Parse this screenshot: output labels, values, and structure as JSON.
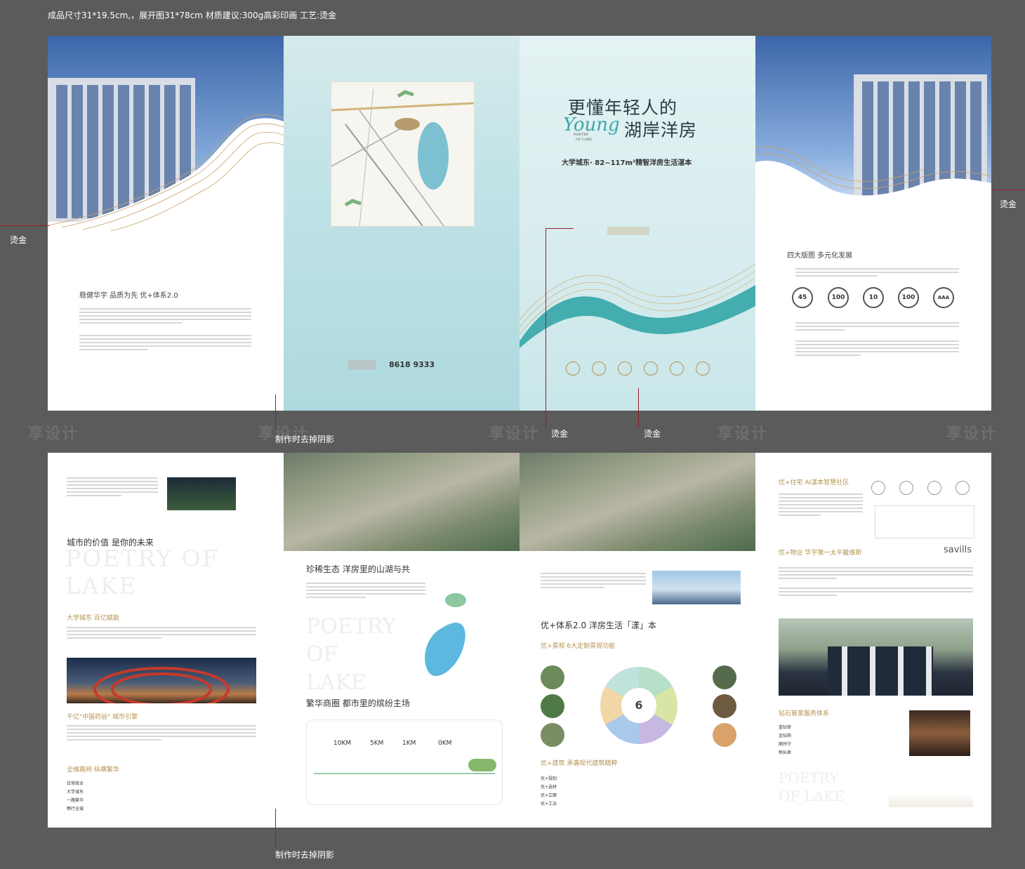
{
  "header": {
    "spec_text": "成品尺寸31*19.5cm,，展开图31*78cm  材质建议:300g高彩印画   工艺:烫金"
  },
  "notes": {
    "hot_stamp_left": "烫金",
    "hot_stamp_right": "烫金",
    "hot_stamp_mid1": "烫金",
    "hot_stamp_mid2": "烫金",
    "remove_shadow_top": "制作时去掉阴影",
    "remove_shadow_bottom": "制作时去掉阴影"
  },
  "watermark": "享设计",
  "page1": {
    "heading": "稳健华宇  品质为先  优+体系2.0"
  },
  "page2": {
    "phone": "8618 9333"
  },
  "cover": {
    "title_line1": "更懂年轻人的",
    "title_line2": "湖岸洋房",
    "script": "Young",
    "sub_en1": "POETRY",
    "sub_en2": "OF LAKE",
    "tagline": "大学城东·",
    "tagline2": "82~117m²精智洋房生活湛本"
  },
  "page4": {
    "heading": "四大版图  多元化发展",
    "badges": [
      "45",
      "100",
      "10",
      "100",
      "AAA"
    ]
  },
  "page5": {
    "intro_heading": "城市的价值  是你的未来",
    "en_watermark": "POETRY OF LAKE",
    "sec1": "大学城东  百亿赋能",
    "sec2": "千亿\"中国药谷\"  城市引擎",
    "sec3": "全维路网  纵横繁华",
    "roads": [
      "日常商业",
      "大学城东",
      "一路繁华",
      "畅行全城"
    ]
  },
  "page6": {
    "heading1": "珍稀生态  洋房里的山湖与共",
    "en_big": "POETRY OF LAKE",
    "heading2": "繁华商圈  都市里的缤纷主场",
    "distances": [
      "10KM",
      "5KM",
      "1KM",
      "0KM"
    ]
  },
  "page7": {
    "heading1": "优+体系2.0  洋房生活「漾」本",
    "sub1": "优+景观  6大定制景观功能",
    "center_num": "6",
    "sub2": "优+建筑  承袭现代建筑精粹",
    "items": [
      "优+规划",
      "优+选材",
      "优+立面",
      "优+工法"
    ]
  },
  "page8": {
    "heading1": "优+住宅  AI漾本智慧社区",
    "heading2": "优+物业  华宇第一太平戴维斯",
    "savills": "savills",
    "heading3": "钻石管家服务体系",
    "services": [
      "蓝钻审",
      "金钻购",
      "随时守",
      "物长君"
    ],
    "en_footer": "POETRY OF LAKE"
  }
}
